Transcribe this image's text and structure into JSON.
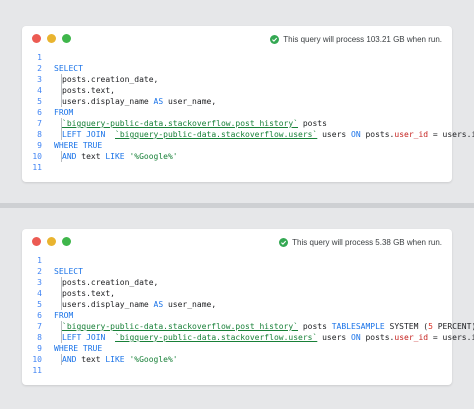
{
  "card1": {
    "status_text": "This query will process 103.21 GB when run.",
    "lines": [
      {
        "n": "1"
      },
      {
        "n": "2",
        "kw": "SELECT"
      },
      {
        "n": "3",
        "t": "posts.creation_date,"
      },
      {
        "n": "4",
        "t": "posts.text,"
      },
      {
        "n": "5",
        "a": "users.display_name ",
        "kw": "AS",
        "b": " user_name,"
      },
      {
        "n": "6",
        "kw": "FROM"
      },
      {
        "n": "7",
        "tbl": "`bigquery-public-data.stackoverflow.post_history`",
        "b": " posts"
      },
      {
        "n": "8",
        "kw": "LEFT JOIN",
        "tbl": "`bigquery-public-data.stackoverflow.users`",
        "a": " users ",
        "kw2": "ON",
        "b": " posts.",
        "col": "user_id",
        "c": " = users.id"
      },
      {
        "n": "9",
        "kw": "WHERE TRUE"
      },
      {
        "n": "10",
        "kw": "AND",
        "a": " text ",
        "kw2": "LIKE",
        "str": " '%Google%'"
      },
      {
        "n": "11"
      }
    ]
  },
  "card2": {
    "status_text": "This query will process 5.38 GB when run.",
    "lines": [
      {
        "n": "1"
      },
      {
        "n": "2",
        "kw": "SELECT"
      },
      {
        "n": "3",
        "t": "posts.creation_date,"
      },
      {
        "n": "4",
        "t": "posts.text,"
      },
      {
        "n": "5",
        "a": "users.display_name ",
        "kw": "AS",
        "b": " user_name,"
      },
      {
        "n": "6",
        "kw": "FROM"
      },
      {
        "n": "7",
        "tbl": "`bigquery-public-data.stackoverflow.post_history`",
        "a": " posts ",
        "kw": "TABLESAMPLE",
        "b": " SYSTEM (",
        "num": "5",
        "c": " PERCENT)"
      },
      {
        "n": "8",
        "kw": "LEFT JOIN",
        "tbl": "`bigquery-public-data.stackoverflow.users`",
        "a": " users ",
        "kw2": "ON",
        "b": " posts.",
        "col": "user_id",
        "c": " = users.id"
      },
      {
        "n": "9",
        "kw": "WHERE TRUE"
      },
      {
        "n": "10",
        "kw": "AND",
        "a": " text ",
        "kw2": "LIKE",
        "str": " '%Google%'"
      },
      {
        "n": "11"
      }
    ]
  },
  "colors": {
    "keyword": "#1a73e8",
    "table": "#188038",
    "number": "#d93025",
    "line_number": "#4285f4",
    "check": "#34a853"
  }
}
